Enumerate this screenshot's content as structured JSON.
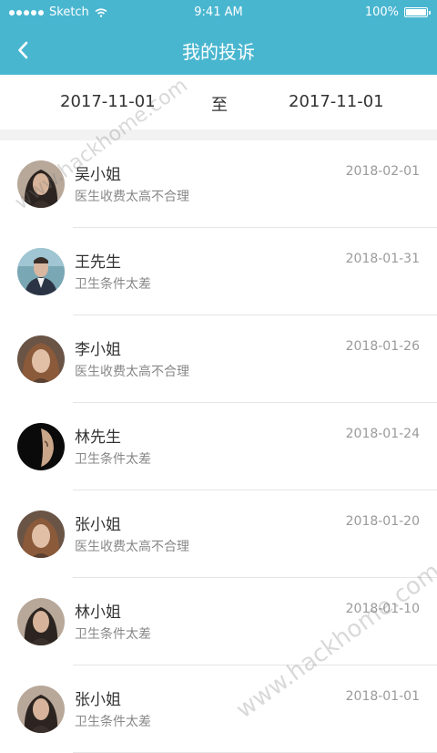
{
  "status_bar": {
    "carrier": "Sketch",
    "time": "9:41 AM",
    "battery": "100%",
    "battery_level": 1.0
  },
  "nav": {
    "back_icon": "chevron-left-icon",
    "title": "我的投诉"
  },
  "date_filter": {
    "start": "2017-11-01",
    "separator": "至",
    "end": "2017-11-01"
  },
  "complaints": [
    {
      "name": "吴小姐",
      "desc": "医生收费太高不合理",
      "date": "2018-02-01",
      "avatar": "avatar-woman-dark-hair"
    },
    {
      "name": "王先生",
      "desc": "卫生条件太差",
      "date": "2018-01-31",
      "avatar": "avatar-man-suit"
    },
    {
      "name": "李小姐",
      "desc": "医生收费太高不合理",
      "date": "2018-01-26",
      "avatar": "avatar-woman-curly"
    },
    {
      "name": "林先生",
      "desc": "卫生条件太差",
      "date": "2018-01-24",
      "avatar": "avatar-man-shadow"
    },
    {
      "name": "张小姐",
      "desc": "医生收费太高不合理",
      "date": "2018-01-20",
      "avatar": "avatar-woman-curly"
    },
    {
      "name": "林小姐",
      "desc": "卫生条件太差",
      "date": "2018-01-10",
      "avatar": "avatar-woman-dark-hair"
    },
    {
      "name": "张小姐",
      "desc": "卫生条件太差",
      "date": "2018-01-01",
      "avatar": "avatar-woman-dark-hair"
    }
  ],
  "watermarks": [
    "www.hackhome.com",
    "www.hackhome.com"
  ],
  "colors": {
    "primary": "#49b6d0",
    "text": "#333333",
    "subtext": "#888888",
    "divider": "#e5e5e5"
  }
}
